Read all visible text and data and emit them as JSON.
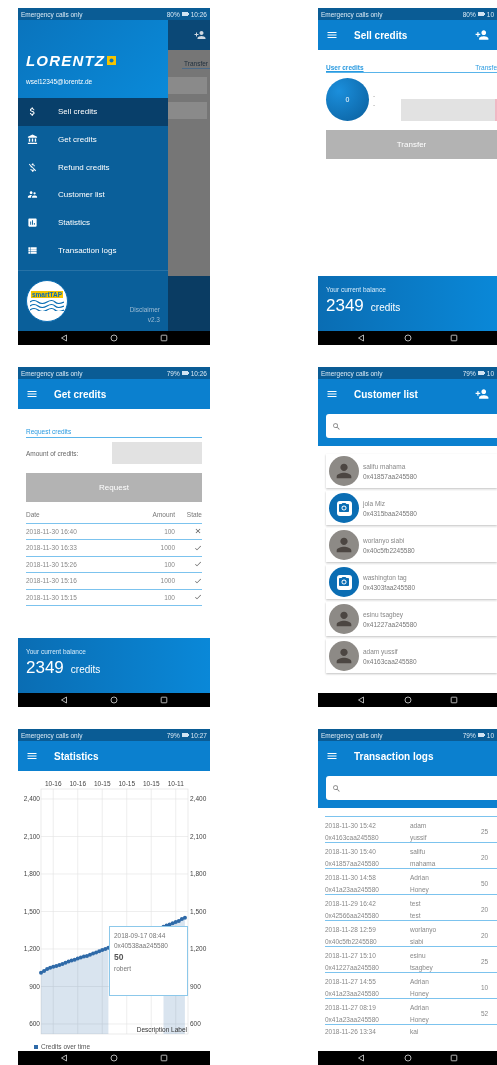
{
  "screens": [
    {
      "kind": "drawer",
      "status": {
        "carrier": "Emergency calls only",
        "battery": "80%",
        "time": "10:26"
      },
      "logo": "LORENTZ",
      "email": "wsel12345@lorentz.de",
      "behind_tab": "Transfer",
      "items": [
        {
          "label": "Sell credits",
          "selected": true
        },
        {
          "label": "Get credits",
          "selected": false
        },
        {
          "label": "Refund credits",
          "selected": false
        },
        {
          "label": "Customer list",
          "selected": false
        },
        {
          "label": "Statistics",
          "selected": false
        },
        {
          "label": "Transaction logs",
          "selected": false
        }
      ],
      "badge": "smartTAP",
      "disclaimer": "Disclaimer",
      "version": "v2.3"
    },
    {
      "kind": "sell",
      "status": {
        "carrier": "Emergency calls only",
        "battery": "80%",
        "time": "10"
      },
      "title": "Sell credits",
      "tabs": [
        {
          "label": "User credits",
          "selected": true
        },
        {
          "label": "Transfe",
          "selected": false
        }
      ],
      "user_credits": "0",
      "details": [
        "-",
        "-"
      ],
      "button": {
        "label": "Transfer",
        "disabled": true
      },
      "balance": {
        "label": "Your current balance",
        "amount": "2349",
        "unit": "credits"
      }
    },
    {
      "kind": "get",
      "status": {
        "carrier": "Emergency calls only",
        "battery": "79%",
        "time": "10:26"
      },
      "title": "Get credits",
      "section": "Request credits",
      "field_label": "Amount of credits:",
      "button": {
        "label": "Request",
        "disabled": true
      },
      "columns": [
        "Date",
        "Amount",
        "State"
      ],
      "rows": [
        {
          "date": "2018-11-30 16:40",
          "amount": "100",
          "approved": false
        },
        {
          "date": "2018-11-30 16:33",
          "amount": "1000",
          "approved": true
        },
        {
          "date": "2018-11-30 15:26",
          "amount": "100",
          "approved": true
        },
        {
          "date": "2018-11-30 15:16",
          "amount": "1000",
          "approved": true
        },
        {
          "date": "2018-11-30 15:15",
          "amount": "100",
          "approved": true
        }
      ],
      "balance": {
        "label": "Your current balance",
        "amount": "2349",
        "unit": "credits"
      }
    },
    {
      "kind": "customers",
      "status": {
        "carrier": "Emergency calls only",
        "battery": "79%",
        "time": "10"
      },
      "title": "Customer list",
      "customers": [
        {
          "name": "salifu mahama",
          "address": "0x41857aa245580",
          "kind": "photo"
        },
        {
          "name": "jola Miz",
          "address": "0x4315baa245580",
          "kind": "camera"
        },
        {
          "name": "worlanyo siabi",
          "address": "0x40c5fb2245580",
          "kind": "photo"
        },
        {
          "name": "washington tag",
          "address": "0x4303faa245580",
          "kind": "camera"
        },
        {
          "name": "esinu tsagbey",
          "address": "0x41227aa245580",
          "kind": "photo"
        },
        {
          "name": "adam yussif",
          "address": "0x4163caa245580",
          "kind": "photo"
        }
      ]
    },
    {
      "kind": "statistics",
      "status": {
        "carrier": "Emergency calls only",
        "battery": "79%",
        "time": "10:27"
      },
      "title": "Statistics",
      "chart_data": {
        "type": "area",
        "categories": [
          null,
          null,
          null,
          null,
          "10-16",
          null,
          null,
          null,
          null,
          null,
          null,
          null,
          "10-16",
          null,
          null,
          null,
          null,
          null,
          null,
          null,
          "10-15",
          null,
          null,
          null,
          null,
          null,
          null,
          null,
          "10-15",
          null,
          null,
          null,
          null,
          null,
          null,
          null,
          "10-15",
          null,
          null,
          null,
          null,
          null,
          null,
          null,
          "10-11",
          null,
          null,
          null
        ],
        "series": [
          {
            "name": "Credits over time",
            "color": "#2f6aa8",
            "values": [
              1010,
              1025,
              1040,
              1050,
              1058,
              1065,
              1072,
              1080,
              1090,
              1100,
              1108,
              1115,
              1125,
              1132,
              1140,
              1145,
              1154,
              1164,
              1173,
              1182,
              1192,
              1201,
              1210,
              null,
              null,
              null,
              null,
              null,
              null,
              null,
              null,
              null,
              null,
              null,
              null,
              null,
              null,
              null,
              null,
              null,
              1378,
              1388,
              1397,
              1406,
              1416,
              1425,
              1440,
              1450
            ]
          }
        ],
        "ylim": [
          520,
          2480
        ],
        "grid": true,
        "yticks": [
          {
            "value": 600,
            "label": "600"
          },
          {
            "value": 900,
            "label": "900"
          },
          {
            "value": 1200,
            "label": "1,200"
          },
          {
            "value": 1500,
            "label": "1,500"
          },
          {
            "value": 1800,
            "label": "1,800"
          },
          {
            "value": 2100,
            "label": "2,100"
          },
          {
            "value": 2400,
            "label": "2,400"
          }
        ],
        "annotations": [
          "Description Label"
        ]
      },
      "tooltip": {
        "date": "2018-09-17 08:44",
        "address": "0x40538aa245580",
        "amount": "50",
        "name": "robert"
      }
    },
    {
      "kind": "logs",
      "status": {
        "carrier": "Emergency calls only",
        "battery": "79%",
        "time": "10"
      },
      "title": "Transaction logs",
      "rows": [
        {
          "date": "2018-11-30 15:42",
          "address": "0x4163caa245580",
          "first": "adam",
          "last": "yussif",
          "amount": "25"
        },
        {
          "date": "2018-11-30 15:40",
          "address": "0x41857aa245580",
          "first": "salifu",
          "last": "mahama",
          "amount": "20"
        },
        {
          "date": "2018-11-30 14:58",
          "address": "0x41a23aa245580",
          "first": "Adrian",
          "last": "Honey",
          "amount": "50"
        },
        {
          "date": "2018-11-29 16:42",
          "address": "0x42566aa245580",
          "first": "test",
          "last": "test",
          "amount": "20"
        },
        {
          "date": "2018-11-28 12:59",
          "address": "0x40c5fb2245580",
          "first": "worlanyo",
          "last": "siabi",
          "amount": "20"
        },
        {
          "date": "2018-11-27 15:10",
          "address": "0x41227aa245580",
          "first": "esinu",
          "last": "tsagbey",
          "amount": "25"
        },
        {
          "date": "2018-11-27 14:55",
          "address": "0x41a23aa245580",
          "first": "Adrian",
          "last": "Honey",
          "amount": "10"
        },
        {
          "date": "2018-11-27 08:19",
          "address": "0x41a23aa245580",
          "first": "Adrian",
          "last": "Honey",
          "amount": "52"
        },
        {
          "date": "2018-11-26 13:34",
          "first": "kai"
        }
      ]
    }
  ]
}
